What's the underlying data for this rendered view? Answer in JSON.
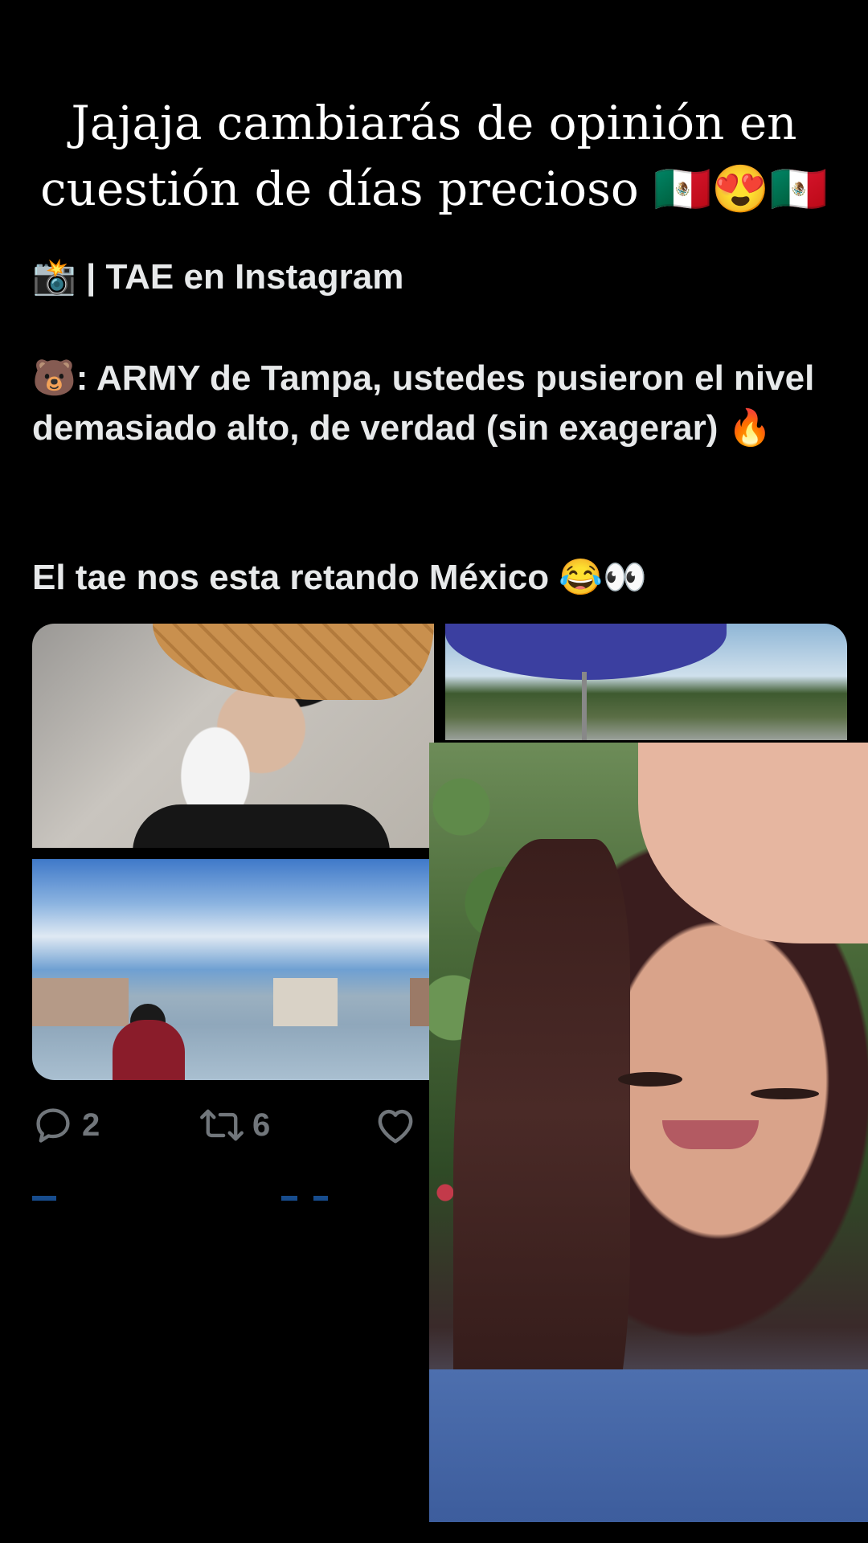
{
  "overlay_caption": "Jajaja cambiarás de opinión en cuestión de días precioso 🇲🇽😍🇲🇽",
  "tweet": {
    "heading": "📸 | TAE en Instagram",
    "quote": "🐻: ARMY de Tampa, ustedes pusieron el nivel demasiado alto, de verdad (sin exagerar) 🔥",
    "closing": "El tae nos esta retando México 😂👀",
    "actions": {
      "replies": "2",
      "retweets": "6",
      "likes": ""
    },
    "icons": {
      "reply": "reply-icon",
      "retweet": "retweet-icon",
      "like": "heart-icon"
    }
  },
  "colors": {
    "background": "#000000",
    "text": "#e7e9ea",
    "muted": "#71767b"
  }
}
